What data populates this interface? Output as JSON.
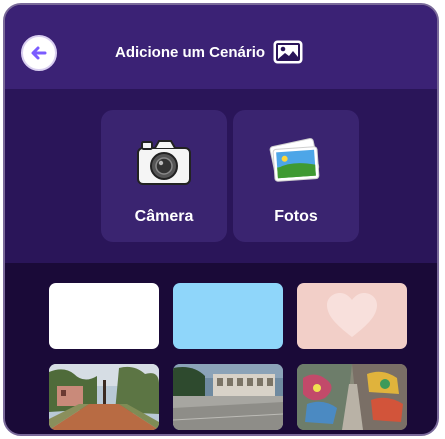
{
  "header": {
    "title": "Adicione um Cenário",
    "back_icon": "arrow-left-icon",
    "title_icon": "image-icon"
  },
  "sources": [
    {
      "label": "Câmera",
      "icon": "camera-icon"
    },
    {
      "label": "Fotos",
      "icon": "photos-icon"
    }
  ],
  "backdrops": [
    {
      "kind": "solid-white",
      "color": "#ffffff"
    },
    {
      "kind": "solid-blue",
      "color": "#8fd6fa"
    },
    {
      "kind": "heart-pink",
      "color": "#f2cfc8"
    },
    {
      "kind": "photo-rural-road"
    },
    {
      "kind": "photo-courtyard"
    },
    {
      "kind": "photo-graffiti-alley"
    }
  ],
  "colors": {
    "dialog_bg": "#1e0c40",
    "header_bg": "#3b2275",
    "card_bg": "#3a2470",
    "back_arrow": "#7b5cff"
  }
}
